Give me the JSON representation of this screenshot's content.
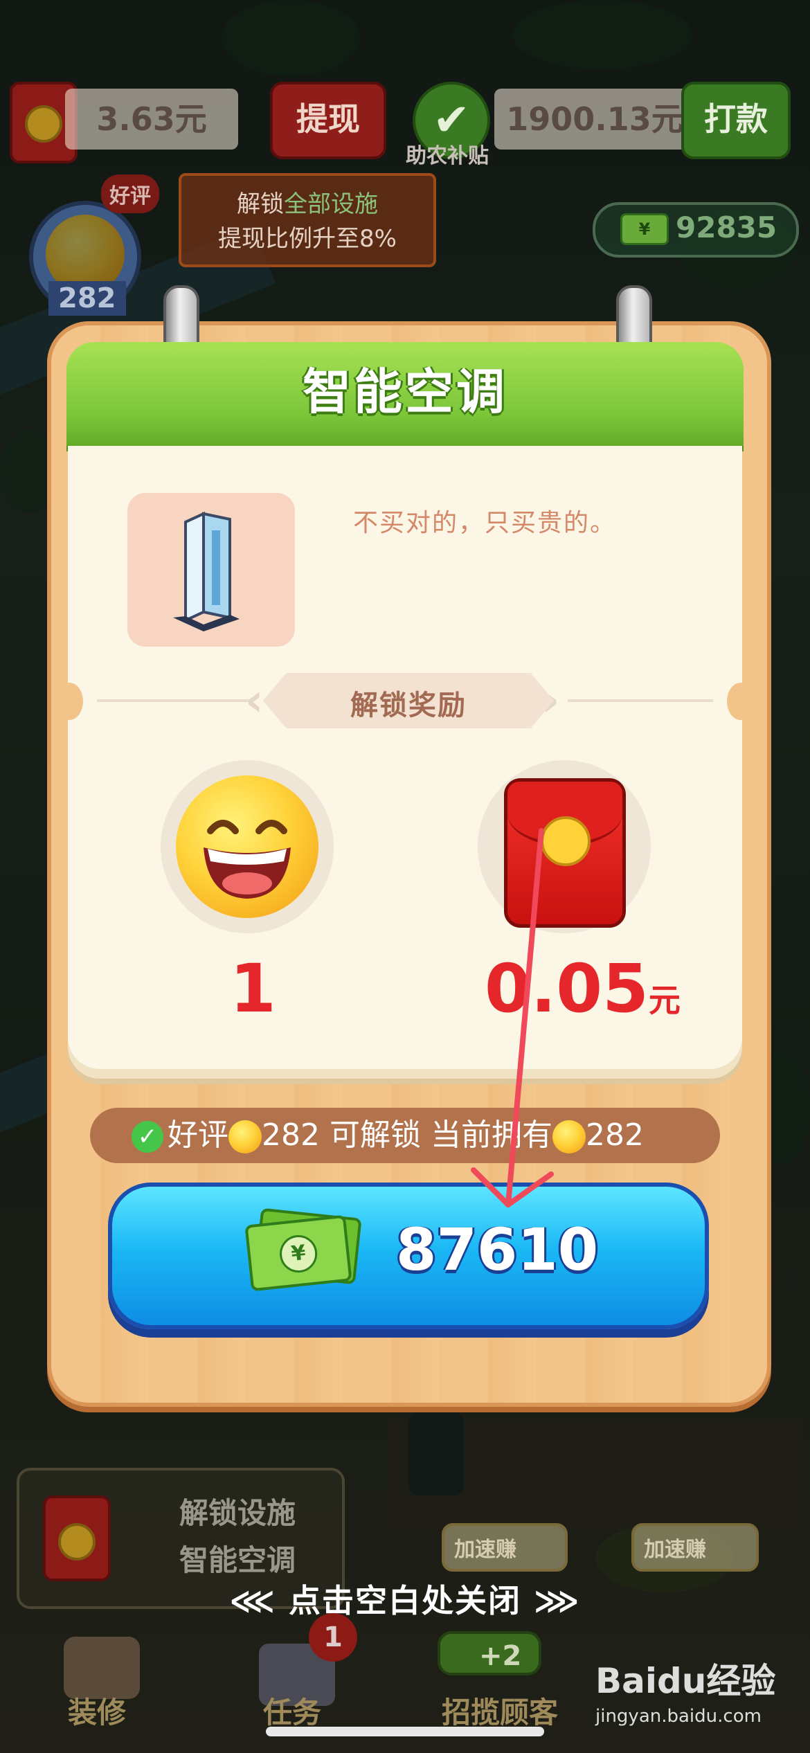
{
  "top_bar": {
    "balance": "3.63元",
    "withdraw_button": "提现",
    "subsidy_amount": "1900.13元",
    "pay_button": "打款",
    "subsidy_label": "助农补贴",
    "notice": {
      "prefix": "解锁",
      "highlight": "全部设施",
      "line2": "提现比例升至8%"
    },
    "cash_count": "92835",
    "good_review_tag": "好评",
    "good_review_count": "282"
  },
  "modal": {
    "title": "智能空调",
    "description": "不买对的，只买贵的。",
    "section_label": "解锁奖励",
    "rewards": [
      {
        "icon": "laughing-emoji-icon",
        "value": "1",
        "unit": ""
      },
      {
        "icon": "red-envelope-icon",
        "value": "0.05",
        "unit": "元"
      }
    ],
    "requirement": {
      "part1": "好评",
      "count_needed": "282",
      "part2": "可解锁 当前拥有",
      "count_owned": "282"
    },
    "buy_button_price": "87610",
    "currency_symbol": "¥"
  },
  "bottom": {
    "unlock_line1": "解锁设施",
    "unlock_line2": "智能空调",
    "close_hint": "点击空白处关闭",
    "speed_earn_1": "加速赚",
    "speed_earn_2": "加速赚",
    "plus_label": "+2",
    "nav": [
      "装修",
      "任务",
      "招揽顾客"
    ],
    "task_badge": "1"
  },
  "watermark": {
    "brand": "Baidu经验",
    "url": "jingyan.baidu.com"
  },
  "colors": {
    "title_green": "#7cc63a",
    "reward_red": "#e5262a",
    "button_blue": "#1bb8f5",
    "check_green": "#45c648"
  }
}
